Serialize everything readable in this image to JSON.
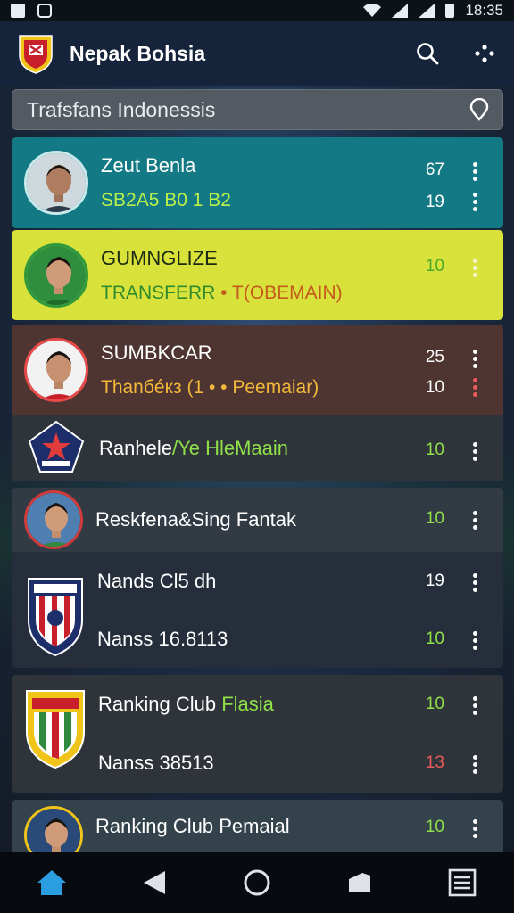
{
  "statusbar": {
    "time": "18:35"
  },
  "app": {
    "title": "Nepak Bohsia"
  },
  "search": {
    "text": "Trafsfans Indonessis"
  },
  "cards": [
    {
      "rows": [
        {
          "name": "Zeut Benla",
          "sub": "SB2A5 B0 1 B2",
          "value1": "67",
          "value2": "19"
        }
      ]
    },
    {
      "rows": [
        {
          "name": "GUMNGLIZE",
          "sub": "TRANSFERR",
          "sub_sep": " • ",
          "sub_tail": "T(OBEMAIN)",
          "value1": "10"
        }
      ]
    },
    {
      "rows": [
        {
          "name": "SUMBKCAR",
          "sub": "Thanбéкз  (1 • • Peemaiar)",
          "value1": "25",
          "value2": "10"
        },
        {
          "name": "Ranhele",
          "name_tail": "/Ye HleMaain",
          "value1": "10"
        }
      ]
    },
    {
      "rows": [
        {
          "name": "Reskfena&Sing Fantak",
          "value1": "10"
        },
        {
          "name": "Nands Cl5 dh",
          "value1": "19"
        },
        {
          "name": "Nanss  16.8113",
          "value1": "10"
        }
      ]
    },
    {
      "rows": [
        {
          "name": "Ranking Club",
          "name_tail": "Flasia",
          "value1": "10"
        },
        {
          "name": "Nanss  38513",
          "value1": "13"
        }
      ]
    },
    {
      "rows": [
        {
          "name": "Ranking Club Pemaial",
          "value1": "10"
        }
      ]
    }
  ],
  "colors": {
    "card_teal": "#137a85",
    "card_yellow": "#d8e23a",
    "card_red_brown": "#4e3532",
    "card_dark": "#2e3439",
    "card_navy": "#262e3c",
    "accent_green": "#7fd63b",
    "accent_red": "#ec5b5b"
  },
  "icons": [
    "search-icon",
    "share-dots-icon",
    "location-pin-icon",
    "more-vert-icon",
    "home-icon",
    "back-icon",
    "home-circle-icon",
    "recents-icon",
    "menu-icon"
  ]
}
